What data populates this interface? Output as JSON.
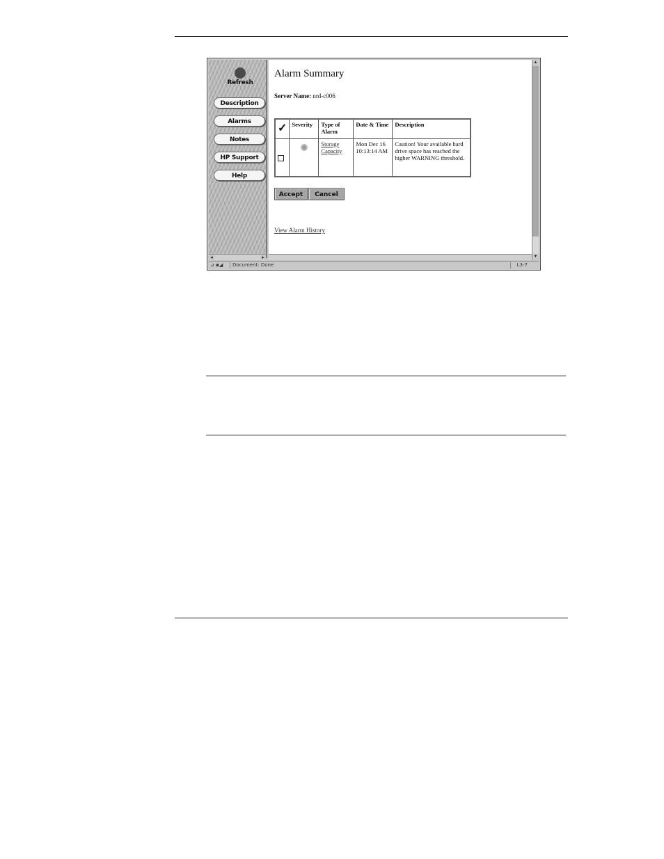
{
  "nav": {
    "refresh_label": "Refresh",
    "items": [
      {
        "label": "Description"
      },
      {
        "label": "Alarms"
      },
      {
        "label": "Notes"
      },
      {
        "label": "HP Support"
      },
      {
        "label": "Help"
      }
    ]
  },
  "main": {
    "title": "Alarm Summary",
    "server_label": "Server Name:",
    "server_value": "nrd-c006",
    "table": {
      "headers": {
        "check": "✓",
        "severity": "Severity",
        "type": "Type of Alarm",
        "date": "Date & Time",
        "description": "Description"
      },
      "rows": [
        {
          "type_link": "Storage Capacity",
          "date": "Mon Dec 16 10:13:14 AM",
          "description": "Caution! Your available hard drive space has reached the higher WARNING threshold."
        }
      ]
    },
    "buttons": {
      "accept": "Accept",
      "cancel": "Cancel"
    },
    "history_link": "View Alarm History"
  },
  "statusbar": {
    "icon": "⊿ ▪◢",
    "text": "Document: Done",
    "zone": "L3-7"
  },
  "colors": {
    "nav_background": "#b3b3b3",
    "button_gray": "#a6a6a6",
    "window_chrome": "#c8c8c8"
  },
  "icons": {
    "refresh": "refresh-icon",
    "severity": "severity-icon",
    "checkmark": "checkmark-icon"
  }
}
